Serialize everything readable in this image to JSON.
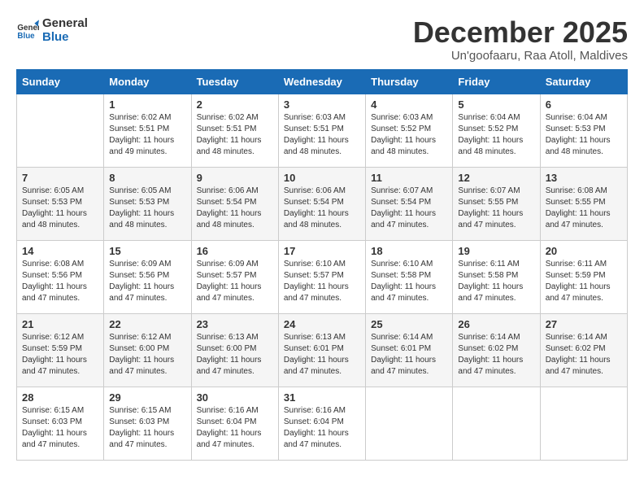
{
  "logo": {
    "text_general": "General",
    "text_blue": "Blue"
  },
  "title": "December 2025",
  "subtitle": "Un'goofaaru, Raa Atoll, Maldives",
  "days_of_week": [
    "Sunday",
    "Monday",
    "Tuesday",
    "Wednesday",
    "Thursday",
    "Friday",
    "Saturday"
  ],
  "weeks": [
    [
      {
        "day": "",
        "sunrise": "",
        "sunset": "",
        "daylight": ""
      },
      {
        "day": "1",
        "sunrise": "6:02 AM",
        "sunset": "5:51 PM",
        "daylight": "11 hours and 49 minutes."
      },
      {
        "day": "2",
        "sunrise": "6:02 AM",
        "sunset": "5:51 PM",
        "daylight": "11 hours and 48 minutes."
      },
      {
        "day": "3",
        "sunrise": "6:03 AM",
        "sunset": "5:51 PM",
        "daylight": "11 hours and 48 minutes."
      },
      {
        "day": "4",
        "sunrise": "6:03 AM",
        "sunset": "5:52 PM",
        "daylight": "11 hours and 48 minutes."
      },
      {
        "day": "5",
        "sunrise": "6:04 AM",
        "sunset": "5:52 PM",
        "daylight": "11 hours and 48 minutes."
      },
      {
        "day": "6",
        "sunrise": "6:04 AM",
        "sunset": "5:53 PM",
        "daylight": "11 hours and 48 minutes."
      }
    ],
    [
      {
        "day": "7",
        "sunrise": "6:05 AM",
        "sunset": "5:53 PM",
        "daylight": "11 hours and 48 minutes."
      },
      {
        "day": "8",
        "sunrise": "6:05 AM",
        "sunset": "5:53 PM",
        "daylight": "11 hours and 48 minutes."
      },
      {
        "day": "9",
        "sunrise": "6:06 AM",
        "sunset": "5:54 PM",
        "daylight": "11 hours and 48 minutes."
      },
      {
        "day": "10",
        "sunrise": "6:06 AM",
        "sunset": "5:54 PM",
        "daylight": "11 hours and 48 minutes."
      },
      {
        "day": "11",
        "sunrise": "6:07 AM",
        "sunset": "5:54 PM",
        "daylight": "11 hours and 47 minutes."
      },
      {
        "day": "12",
        "sunrise": "6:07 AM",
        "sunset": "5:55 PM",
        "daylight": "11 hours and 47 minutes."
      },
      {
        "day": "13",
        "sunrise": "6:08 AM",
        "sunset": "5:55 PM",
        "daylight": "11 hours and 47 minutes."
      }
    ],
    [
      {
        "day": "14",
        "sunrise": "6:08 AM",
        "sunset": "5:56 PM",
        "daylight": "11 hours and 47 minutes."
      },
      {
        "day": "15",
        "sunrise": "6:09 AM",
        "sunset": "5:56 PM",
        "daylight": "11 hours and 47 minutes."
      },
      {
        "day": "16",
        "sunrise": "6:09 AM",
        "sunset": "5:57 PM",
        "daylight": "11 hours and 47 minutes."
      },
      {
        "day": "17",
        "sunrise": "6:10 AM",
        "sunset": "5:57 PM",
        "daylight": "11 hours and 47 minutes."
      },
      {
        "day": "18",
        "sunrise": "6:10 AM",
        "sunset": "5:58 PM",
        "daylight": "11 hours and 47 minutes."
      },
      {
        "day": "19",
        "sunrise": "6:11 AM",
        "sunset": "5:58 PM",
        "daylight": "11 hours and 47 minutes."
      },
      {
        "day": "20",
        "sunrise": "6:11 AM",
        "sunset": "5:59 PM",
        "daylight": "11 hours and 47 minutes."
      }
    ],
    [
      {
        "day": "21",
        "sunrise": "6:12 AM",
        "sunset": "5:59 PM",
        "daylight": "11 hours and 47 minutes."
      },
      {
        "day": "22",
        "sunrise": "6:12 AM",
        "sunset": "6:00 PM",
        "daylight": "11 hours and 47 minutes."
      },
      {
        "day": "23",
        "sunrise": "6:13 AM",
        "sunset": "6:00 PM",
        "daylight": "11 hours and 47 minutes."
      },
      {
        "day": "24",
        "sunrise": "6:13 AM",
        "sunset": "6:01 PM",
        "daylight": "11 hours and 47 minutes."
      },
      {
        "day": "25",
        "sunrise": "6:14 AM",
        "sunset": "6:01 PM",
        "daylight": "11 hours and 47 minutes."
      },
      {
        "day": "26",
        "sunrise": "6:14 AM",
        "sunset": "6:02 PM",
        "daylight": "11 hours and 47 minutes."
      },
      {
        "day": "27",
        "sunrise": "6:14 AM",
        "sunset": "6:02 PM",
        "daylight": "11 hours and 47 minutes."
      }
    ],
    [
      {
        "day": "28",
        "sunrise": "6:15 AM",
        "sunset": "6:03 PM",
        "daylight": "11 hours and 47 minutes."
      },
      {
        "day": "29",
        "sunrise": "6:15 AM",
        "sunset": "6:03 PM",
        "daylight": "11 hours and 47 minutes."
      },
      {
        "day": "30",
        "sunrise": "6:16 AM",
        "sunset": "6:04 PM",
        "daylight": "11 hours and 47 minutes."
      },
      {
        "day": "31",
        "sunrise": "6:16 AM",
        "sunset": "6:04 PM",
        "daylight": "11 hours and 47 minutes."
      },
      {
        "day": "",
        "sunrise": "",
        "sunset": "",
        "daylight": ""
      },
      {
        "day": "",
        "sunrise": "",
        "sunset": "",
        "daylight": ""
      },
      {
        "day": "",
        "sunrise": "",
        "sunset": "",
        "daylight": ""
      }
    ]
  ],
  "labels": {
    "sunrise": "Sunrise:",
    "sunset": "Sunset:",
    "daylight": "Daylight:"
  }
}
